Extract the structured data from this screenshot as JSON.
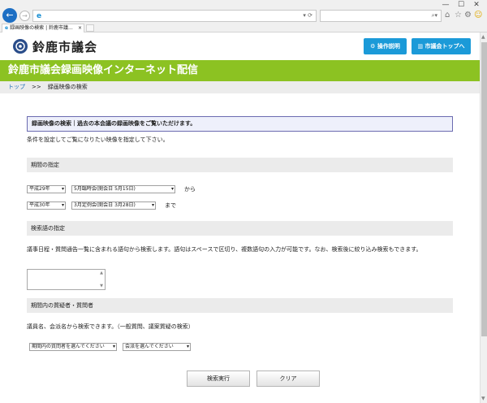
{
  "browser": {
    "tab_label": "録画映像の検索 | 鈴鹿市議...",
    "tab_close": "×",
    "back_icon": "←",
    "forward_icon": "→",
    "address_value": "",
    "address_controls": "▾ ⟳",
    "search_value": "",
    "search_controls": "⌕▾",
    "toolbar_icons": {
      "home": "⌂",
      "star": "☆",
      "gear": "⚙",
      "smiley": "☺"
    },
    "window_controls": {
      "minimize": "—",
      "maximize": "☐",
      "close": "✕"
    }
  },
  "header": {
    "site_name": "鈴鹿市議会",
    "buttons": {
      "operation": "操作説明",
      "top": "市議会トップへ"
    },
    "banner": "鈴鹿市議会録画映像インターネット配信"
  },
  "breadcrumb": {
    "home": "トップ",
    "separator": ">>",
    "current": "録画映像の検索"
  },
  "main": {
    "page_heading": "録画映像の検索｜過去の本会議の録画映像をご覧いただけます。",
    "intro": "条件を設定してご覧になりたい映像を指定して下さい。",
    "period": {
      "heading": "期間の指定",
      "from": {
        "year": "平成29年",
        "session": "5月臨時会(開会日 5月15日)",
        "suffix": "から"
      },
      "to": {
        "year": "平成30年",
        "session": "3月定例会(開会日 3月28日)",
        "suffix": "まで"
      }
    },
    "keyword": {
      "heading": "検索語の指定",
      "description": "議事日程・質問通告一覧に含まれる語句から検索します。語句はスペースで区切り、複数語句の入力が可能です。なお、検索後に絞り込み検索もできます。",
      "value": ""
    },
    "questioner": {
      "heading": "期間内の質疑者・質問者",
      "description": "議員名、会派名から検索できます。（一般質問、議案質疑の検索）",
      "member_select": "期間内の質問者を選んでください",
      "faction_select": "会派を選んでください"
    },
    "actions": {
      "search": "検索実行",
      "clear": "クリア"
    }
  },
  "colors": {
    "banner": "#8cc222",
    "header_button": "#1b9ad8",
    "section_bg": "#ebebeb",
    "heading_box_border": "#6b6bb0"
  }
}
